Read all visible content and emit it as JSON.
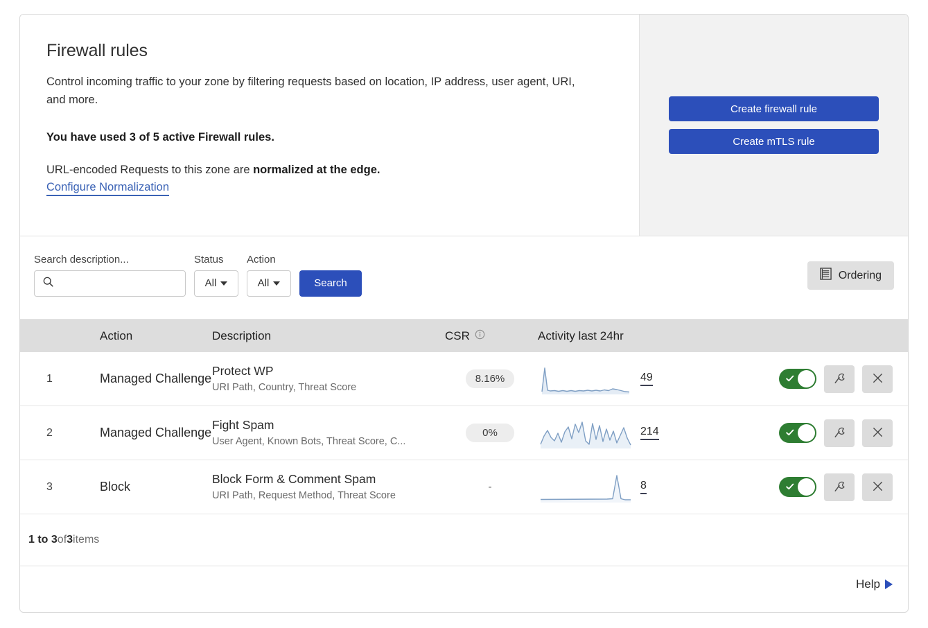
{
  "hero": {
    "title": "Firewall rules",
    "description": "Control incoming traffic to your zone by filtering requests based on location, IP address, user agent, URI, and more.",
    "quota": "You have used 3 of 5 active Firewall rules.",
    "normalization_prefix": "URL-encoded Requests to this zone are ",
    "normalization_bold": "normalized at the edge.",
    "configure_link": "Configure Normalization",
    "create_firewall_rule": "Create firewall rule",
    "create_mtls_rule": "Create mTLS rule"
  },
  "toolbar": {
    "search_label": "Search description...",
    "search_value": "",
    "search_placeholder": "",
    "search_icon": "search-icon",
    "status_label": "Status",
    "status_value": "All",
    "action_label": "Action",
    "action_value": "All",
    "search_button": "Search",
    "ordering_button": "Ordering",
    "ordering_icon": "list-ordering-icon"
  },
  "table": {
    "columns": {
      "num": "",
      "action": "Action",
      "description": "Description",
      "csr": "CSR",
      "csr_info_icon": "info-icon",
      "activity": "Activity last 24hr"
    },
    "rows": [
      {
        "num": "1",
        "action": "Managed Challenge",
        "desc_title": "Protect WP",
        "desc_sub": "URI Path, Country, Threat Score",
        "csr": "8.16%",
        "count": "49",
        "enabled": true,
        "edit_icon": "wrench-icon",
        "delete_icon": "close-icon"
      },
      {
        "num": "2",
        "action": "Managed Challenge",
        "desc_title": "Fight Spam",
        "desc_sub": "User Agent, Known Bots, Threat Score, C...",
        "csr": "0%",
        "count": "214",
        "enabled": true,
        "edit_icon": "wrench-icon",
        "delete_icon": "close-icon"
      },
      {
        "num": "3",
        "action": "Block",
        "desc_title": "Block Form & Comment Spam",
        "desc_sub": "URI Path, Request Method, Threat Score",
        "csr": "-",
        "count": "8",
        "enabled": true,
        "edit_icon": "wrench-icon",
        "delete_icon": "close-icon"
      }
    ]
  },
  "footer": {
    "range_start": "1 to 3",
    "of": " of ",
    "total": "3",
    "items_suffix": " items",
    "help": "Help"
  },
  "colors": {
    "primary_blue": "#2c4fba",
    "link_blue": "#3a62b5",
    "toggle_green": "#2e7d32",
    "spark_line": "#7f9fc4",
    "header_grey": "#dddddd"
  },
  "chart_data": [
    {
      "type": "line",
      "title": "Activity last 24hr",
      "series_name": "Protect WP",
      "total": 49,
      "values": [
        0,
        0,
        38,
        2,
        1,
        1,
        2,
        1,
        2,
        1,
        2,
        1,
        2,
        2,
        1,
        2,
        1,
        2,
        2,
        3,
        2,
        4,
        3,
        5,
        3,
        2,
        1
      ],
      "ylim": [
        0,
        40
      ],
      "grid": false,
      "legend": "none"
    },
    {
      "type": "line",
      "title": "Activity last 24hr",
      "series_name": "Fight Spam",
      "total": 214,
      "values": [
        2,
        10,
        16,
        9,
        5,
        11,
        4,
        12,
        8,
        15,
        7,
        18,
        12,
        20,
        6,
        3,
        19,
        5,
        17,
        4,
        14,
        6,
        12,
        3,
        9,
        14,
        7,
        2
      ],
      "ylim": [
        0,
        20
      ],
      "grid": false,
      "legend": "none"
    },
    {
      "type": "line",
      "title": "Activity last 24hr",
      "series_name": "Block Form & Comment Spam",
      "total": 8,
      "values": [
        0,
        0,
        0,
        0,
        0,
        0,
        0,
        0,
        0,
        0,
        0,
        0,
        0,
        0,
        0,
        0,
        0,
        0,
        0,
        0,
        0,
        8,
        0,
        0,
        0
      ],
      "ylim": [
        0,
        8
      ],
      "grid": false,
      "legend": "none"
    }
  ]
}
